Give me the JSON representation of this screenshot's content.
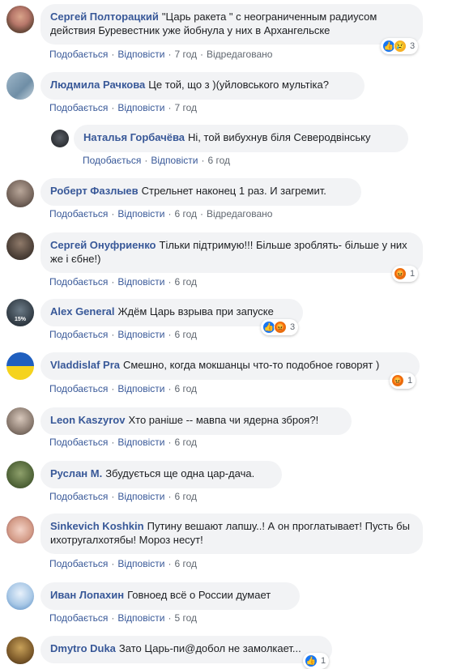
{
  "labels": {
    "like": "Подобається",
    "reply": "Відповісти",
    "edited": "Відредаговано"
  },
  "comments": [
    {
      "name": "Сергей Полторацкий",
      "text": "\"Царь ракета \" с неограниченным радиусом действия Буревестник уже йобнула у них в Архангельске",
      "time": "7 год",
      "reacts": "3"
    },
    {
      "name": "Людмила Рачкова",
      "text": "Це той, що з )(уйловського мультіка?",
      "time": "7 год"
    },
    {
      "name": "Наталья Горбачёва",
      "text": "Ні, той вибухнув біля Северодвінську",
      "time": "6 год"
    },
    {
      "name": "Роберт Фазлыев",
      "text": "Стрельнет наконец 1 раз. И загремит.",
      "time": "6 год"
    },
    {
      "name": "Сергей Онуфриенко",
      "text": "Тільки підтримую!!! Більше зроблять- більше у них же і єбне!)",
      "time": "6 год",
      "reacts": "1"
    },
    {
      "name": "Alex General",
      "text": "Ждём Царь взрыва при запуске",
      "time": "6 год",
      "reacts": "3",
      "badge": "15%"
    },
    {
      "name": "Vladdislaf Pra",
      "text": "Смешно, когда мокшанцы что-то подобное говорят )",
      "time": "6 год",
      "reacts": "1"
    },
    {
      "name": "Leon Kaszyrov",
      "text": "Хто раніше -- мавпа чи ядерна зброя?!",
      "time": "6 год"
    },
    {
      "name": "Руслан М.",
      "text": "Збудується ще одна цар-дача.",
      "time": "6 год"
    },
    {
      "name": "Sinkevich Koshkin",
      "text": "Путину вешают лапшу..! А он проглатывает! Пусть бы ихотругалхотябы! Мороз несут!",
      "time": "6 год"
    },
    {
      "name": "Иван Лопахин",
      "text": "Говноед всё о России думает",
      "time": "5 год"
    },
    {
      "name": "Dmytro Duka",
      "text": "Зато Царь-пи@добол не замолкает...",
      "time": "",
      "reacts": "1"
    }
  ]
}
